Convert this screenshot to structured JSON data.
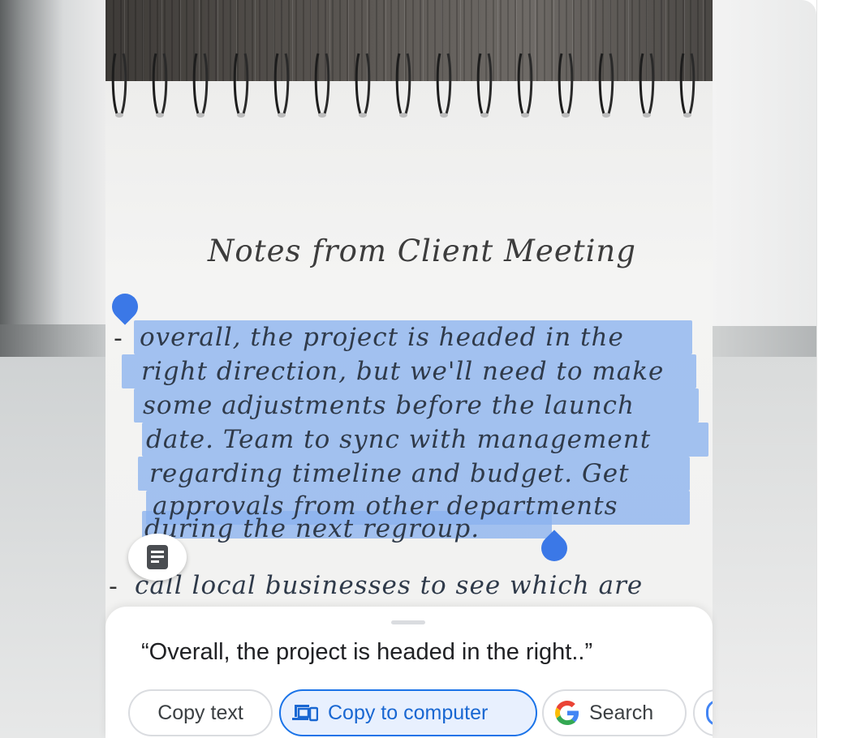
{
  "note": {
    "title": "Notes from Client Meeting",
    "selected_lines": [
      "overall, the project is headed in the",
      "right direction, but we'll need to make",
      "some adjustments before the launch",
      "date. Team to sync with management",
      "regarding timeline and budget. Get",
      "approvals from other departments",
      "during the next regroup."
    ],
    "next_line": "call local businesses to see which are",
    "bullet": "-"
  },
  "sheet": {
    "quote": "“Overall, the project is headed in the right..”",
    "actions": [
      {
        "label": "Copy text",
        "icon": "none"
      },
      {
        "label": "Copy to computer",
        "icon": "devices-icon"
      },
      {
        "label": "Search",
        "icon": "google-g-icon"
      }
    ]
  },
  "colors": {
    "highlight": "#8ab2ee",
    "handle": "#3b78e7",
    "primary_chip_bg": "#e8f0fe",
    "primary_chip_text": "#1967d2"
  }
}
